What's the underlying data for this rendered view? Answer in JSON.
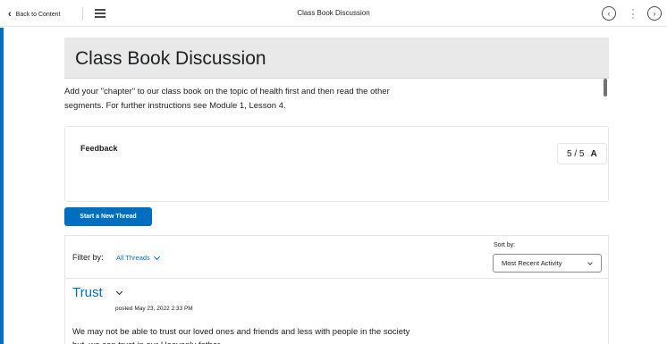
{
  "topbar": {
    "back_label": "Back to Content",
    "title": "Class Book Discussion",
    "prev_icon": "chevron-left-circle-icon",
    "next_icon": "chevron-right-circle-icon"
  },
  "topic": {
    "title": "Class Book Discussion",
    "description": "Add your \"chapter\" to our class book on the topic of health first and then read the other segments. For further instructions see Module 1, Lesson 4."
  },
  "feedback": {
    "label": "Feedback",
    "score": "5 / 5",
    "grade": "A"
  },
  "actions": {
    "new_thread_label": "Start a New Thread"
  },
  "filter": {
    "label": "Filter by:",
    "selected": "All Threads"
  },
  "sort": {
    "label": "Sort by:",
    "selected": "Most Recent Activity"
  },
  "thread": {
    "title": "Trust",
    "posted": "posted May 23, 2022 2:33 PM",
    "body": "We may not be able to trust our loved ones and friends and less with people in the society but, we can trust in our Heavenly father."
  },
  "colors": {
    "accent": "#006fbf",
    "banner": "#e9e9e9"
  }
}
